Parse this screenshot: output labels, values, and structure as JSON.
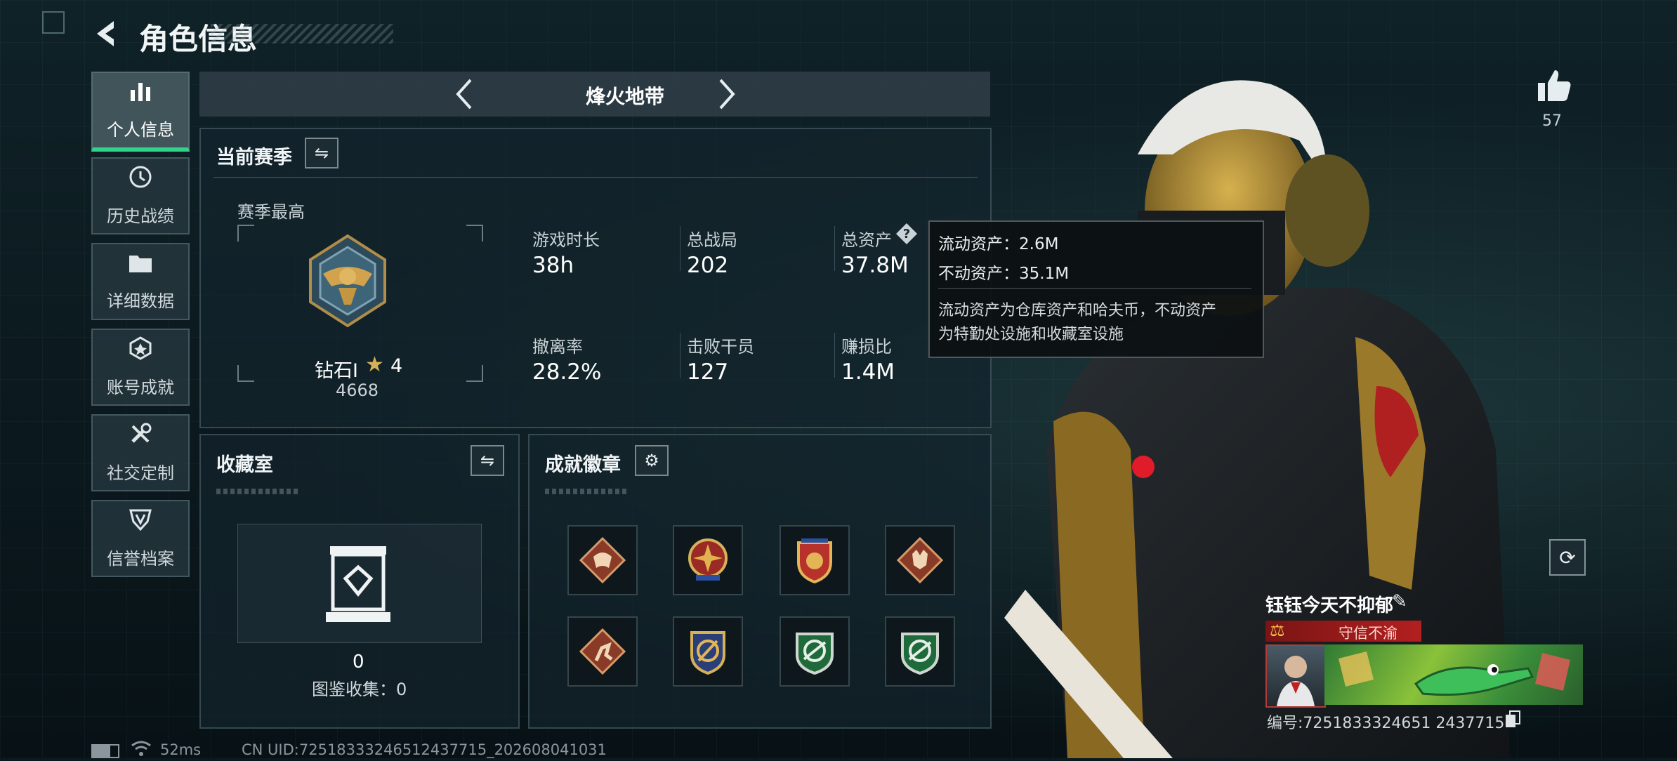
{
  "header": {
    "title": "角色信息"
  },
  "sidebar": {
    "items": [
      {
        "label": "个人信息",
        "icon": "bar-chart-icon"
      },
      {
        "label": "历史战绩",
        "icon": "history-icon"
      },
      {
        "label": "详细数据",
        "icon": "folder-icon"
      },
      {
        "label": "账号成就",
        "icon": "achievement-icon"
      },
      {
        "label": "社交定制",
        "icon": "tools-icon"
      },
      {
        "label": "信誉档案",
        "icon": "shield-icon"
      }
    ]
  },
  "mode_selector": {
    "label": "烽火地带"
  },
  "season": {
    "title": "当前赛季",
    "peak_label": "赛季最高",
    "rank": "钻石Ⅰ",
    "stars": "4",
    "score": "4668",
    "stats": [
      {
        "label": "游戏时长",
        "value": "38h"
      },
      {
        "label": "总战局",
        "value": "202"
      },
      {
        "label": "总资产",
        "value": "37.8M"
      },
      {
        "label": "撤离率",
        "value": "28.2%"
      },
      {
        "label": "击败干员",
        "value": "127"
      },
      {
        "label": "赚损比",
        "value": "1.4M"
      }
    ]
  },
  "tooltip": {
    "liquid": "流动资产：2.6M",
    "fixed": "不动资产：35.1M",
    "line1": "流动资产为仓库资产和哈夫币，不动资产",
    "line2": "为特勤处设施和收藏室设施"
  },
  "collection": {
    "title": "收藏室",
    "count": "0",
    "collected": "图鉴收集：0"
  },
  "achievements": {
    "title": "成就徽章"
  },
  "likes": {
    "count": "57"
  },
  "player": {
    "name": "钰钰今天不抑郁",
    "honor": "守信不渝",
    "id": "编号:7251833324651 2437715"
  },
  "status_bar": {
    "ping": "52ms",
    "uid": "CN UID:72518333246512437715_202608041031"
  },
  "colors": {
    "accent_green": "#2fd48a",
    "honor_red": "#a01818"
  }
}
